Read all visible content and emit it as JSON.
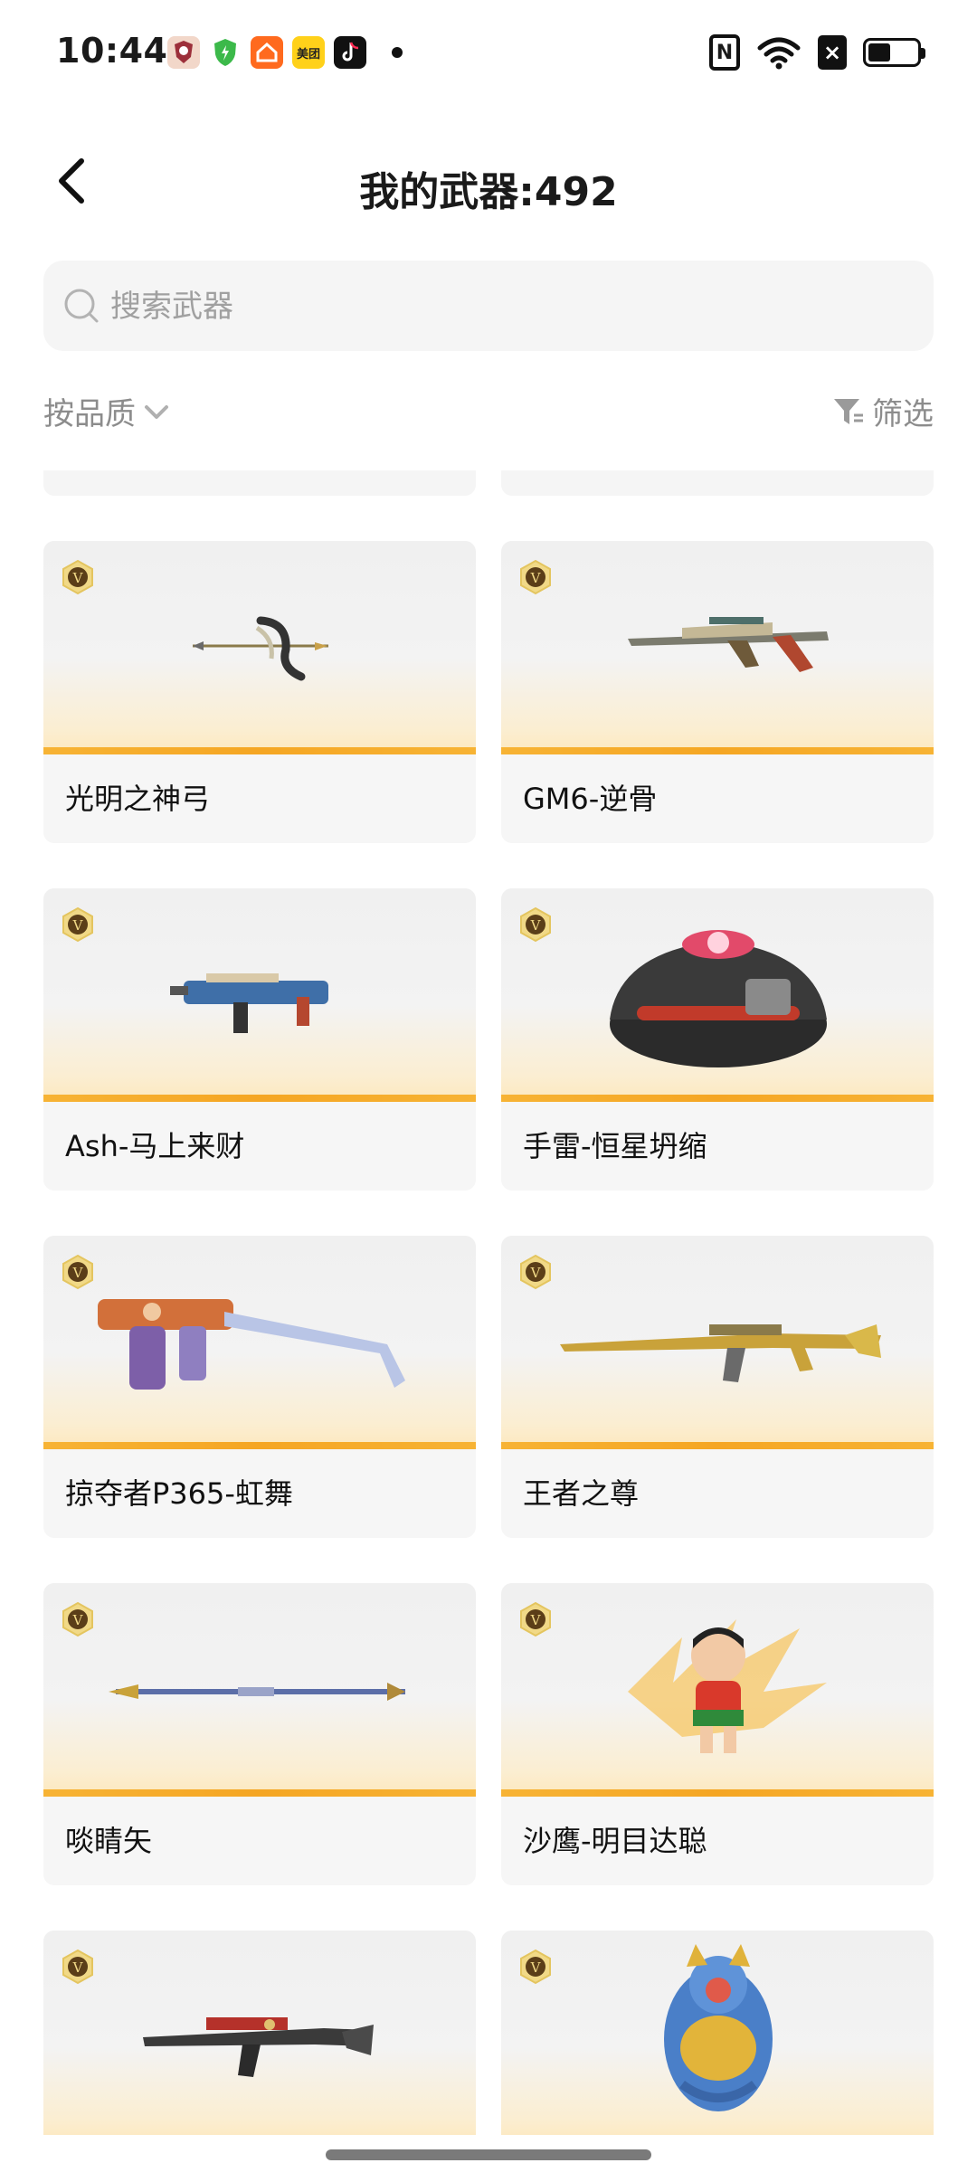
{
  "status_bar": {
    "time": "10:44",
    "app_icons": [
      "game-app-icon",
      "security-shield-icon",
      "home-app-icon",
      "meituan-icon",
      "tiktok-icon"
    ],
    "meituan_label": "美团",
    "nfc_label": "N"
  },
  "header": {
    "title": "我的武器:492",
    "back_icon": "chevron-left-icon"
  },
  "search": {
    "placeholder": "搜索武器",
    "value": ""
  },
  "filters": {
    "sort_label": "按品质",
    "filter_label": "筛选"
  },
  "badge_letter": "V",
  "weapons": [
    {
      "name": "光明之神弓",
      "icon": "bow-icon"
    },
    {
      "name": "GM6-逆骨",
      "icon": "sniper-rifle-icon"
    },
    {
      "name": "Ash-马上来财",
      "icon": "smg-icon"
    },
    {
      "name": "手雷-恒星坍缩",
      "icon": "grenade-icon"
    },
    {
      "name": "掠夺者P365-虹舞",
      "icon": "pistol-stock-icon"
    },
    {
      "name": "王者之尊",
      "icon": "golden-rifle-icon"
    },
    {
      "name": "啖睛矢",
      "icon": "spear-icon"
    },
    {
      "name": "沙鹰-明目达聪",
      "icon": "calabash-brother-icon"
    },
    {
      "name": "",
      "icon": "assault-rifle-icon"
    },
    {
      "name": "",
      "icon": "dragon-figure-icon"
    }
  ],
  "colors": {
    "accent": "#F5A623",
    "card_bg": "#F6F6F6",
    "muted_text": "#8C8C8C"
  }
}
